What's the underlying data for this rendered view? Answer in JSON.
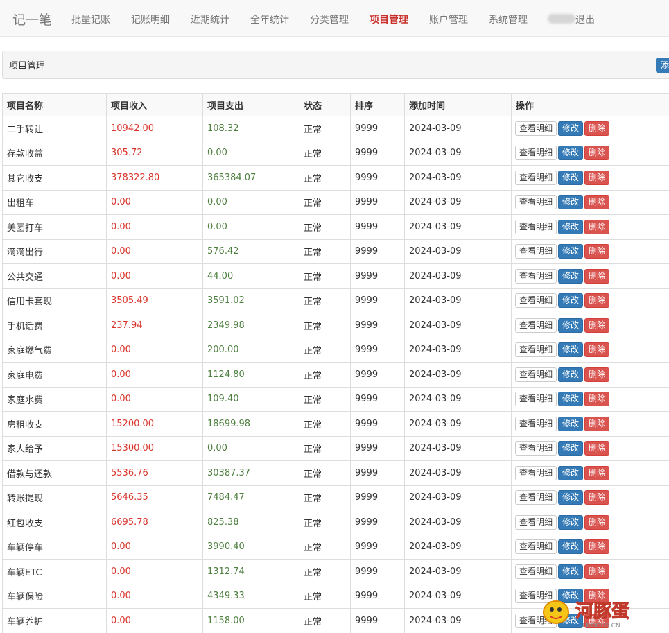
{
  "nav": {
    "brand": "记一笔",
    "items": [
      {
        "label": "批量记账"
      },
      {
        "label": "记账明细"
      },
      {
        "label": "近期统计"
      },
      {
        "label": "全年统计"
      },
      {
        "label": "分类管理"
      },
      {
        "label": "项目管理",
        "active": true
      },
      {
        "label": "账户管理"
      },
      {
        "label": "系统管理"
      }
    ],
    "logout": "退出"
  },
  "panel": {
    "title": "项目管理",
    "add_button": "添"
  },
  "table": {
    "headers": [
      "项目名称",
      "项目收入",
      "项目支出",
      "状态",
      "排序",
      "添加时间",
      "操作"
    ],
    "actions": {
      "detail": "查看明细",
      "edit": "修改",
      "delete": "删除"
    },
    "rows": [
      {
        "name": "二手转让",
        "income": "10942.00",
        "expense": "108.32",
        "status": "正常",
        "sort": "9999",
        "date": "2024-03-09"
      },
      {
        "name": "存款收益",
        "income": "305.72",
        "expense": "0.00",
        "status": "正常",
        "sort": "9999",
        "date": "2024-03-09"
      },
      {
        "name": "其它收支",
        "income": "378322.80",
        "expense": "365384.07",
        "status": "正常",
        "sort": "9999",
        "date": "2024-03-09"
      },
      {
        "name": "出租车",
        "income": "0.00",
        "expense": "0.00",
        "status": "正常",
        "sort": "9999",
        "date": "2024-03-09"
      },
      {
        "name": "美团打车",
        "income": "0.00",
        "expense": "0.00",
        "status": "正常",
        "sort": "9999",
        "date": "2024-03-09"
      },
      {
        "name": "滴滴出行",
        "income": "0.00",
        "expense": "576.42",
        "status": "正常",
        "sort": "9999",
        "date": "2024-03-09"
      },
      {
        "name": "公共交通",
        "income": "0.00",
        "expense": "44.00",
        "status": "正常",
        "sort": "9999",
        "date": "2024-03-09"
      },
      {
        "name": "信用卡套现",
        "income": "3505.49",
        "expense": "3591.02",
        "status": "正常",
        "sort": "9999",
        "date": "2024-03-09"
      },
      {
        "name": "手机话费",
        "income": "237.94",
        "expense": "2349.98",
        "status": "正常",
        "sort": "9999",
        "date": "2024-03-09"
      },
      {
        "name": "家庭燃气费",
        "income": "0.00",
        "expense": "200.00",
        "status": "正常",
        "sort": "9999",
        "date": "2024-03-09"
      },
      {
        "name": "家庭电费",
        "income": "0.00",
        "expense": "1124.80",
        "status": "正常",
        "sort": "9999",
        "date": "2024-03-09"
      },
      {
        "name": "家庭水费",
        "income": "0.00",
        "expense": "109.40",
        "status": "正常",
        "sort": "9999",
        "date": "2024-03-09"
      },
      {
        "name": "房租收支",
        "income": "15200.00",
        "expense": "18699.98",
        "status": "正常",
        "sort": "9999",
        "date": "2024-03-09"
      },
      {
        "name": "家人给予",
        "income": "15300.00",
        "expense": "0.00",
        "status": "正常",
        "sort": "9999",
        "date": "2024-03-09"
      },
      {
        "name": "借款与还款",
        "income": "5536.76",
        "expense": "30387.37",
        "status": "正常",
        "sort": "9999",
        "date": "2024-03-09"
      },
      {
        "name": "转账提现",
        "income": "5646.35",
        "expense": "7484.47",
        "status": "正常",
        "sort": "9999",
        "date": "2024-03-09"
      },
      {
        "name": "红包收支",
        "income": "6695.78",
        "expense": "825.38",
        "status": "正常",
        "sort": "9999",
        "date": "2024-03-09"
      },
      {
        "name": "车辆停车",
        "income": "0.00",
        "expense": "3990.40",
        "status": "正常",
        "sort": "9999",
        "date": "2024-03-09"
      },
      {
        "name": "车辆ETC",
        "income": "0.00",
        "expense": "1312.74",
        "status": "正常",
        "sort": "9999",
        "date": "2024-03-09"
      },
      {
        "name": "车辆保险",
        "income": "0.00",
        "expense": "4349.33",
        "status": "正常",
        "sort": "9999",
        "date": "2024-03-09"
      },
      {
        "name": "车辆养护",
        "income": "0.00",
        "expense": "1158.00",
        "status": "正常",
        "sort": "9999",
        "date": "2024-03-09"
      }
    ]
  },
  "watermark": {
    "text": "河豚蛋",
    "subtext": "HEDOUS.CN"
  }
}
